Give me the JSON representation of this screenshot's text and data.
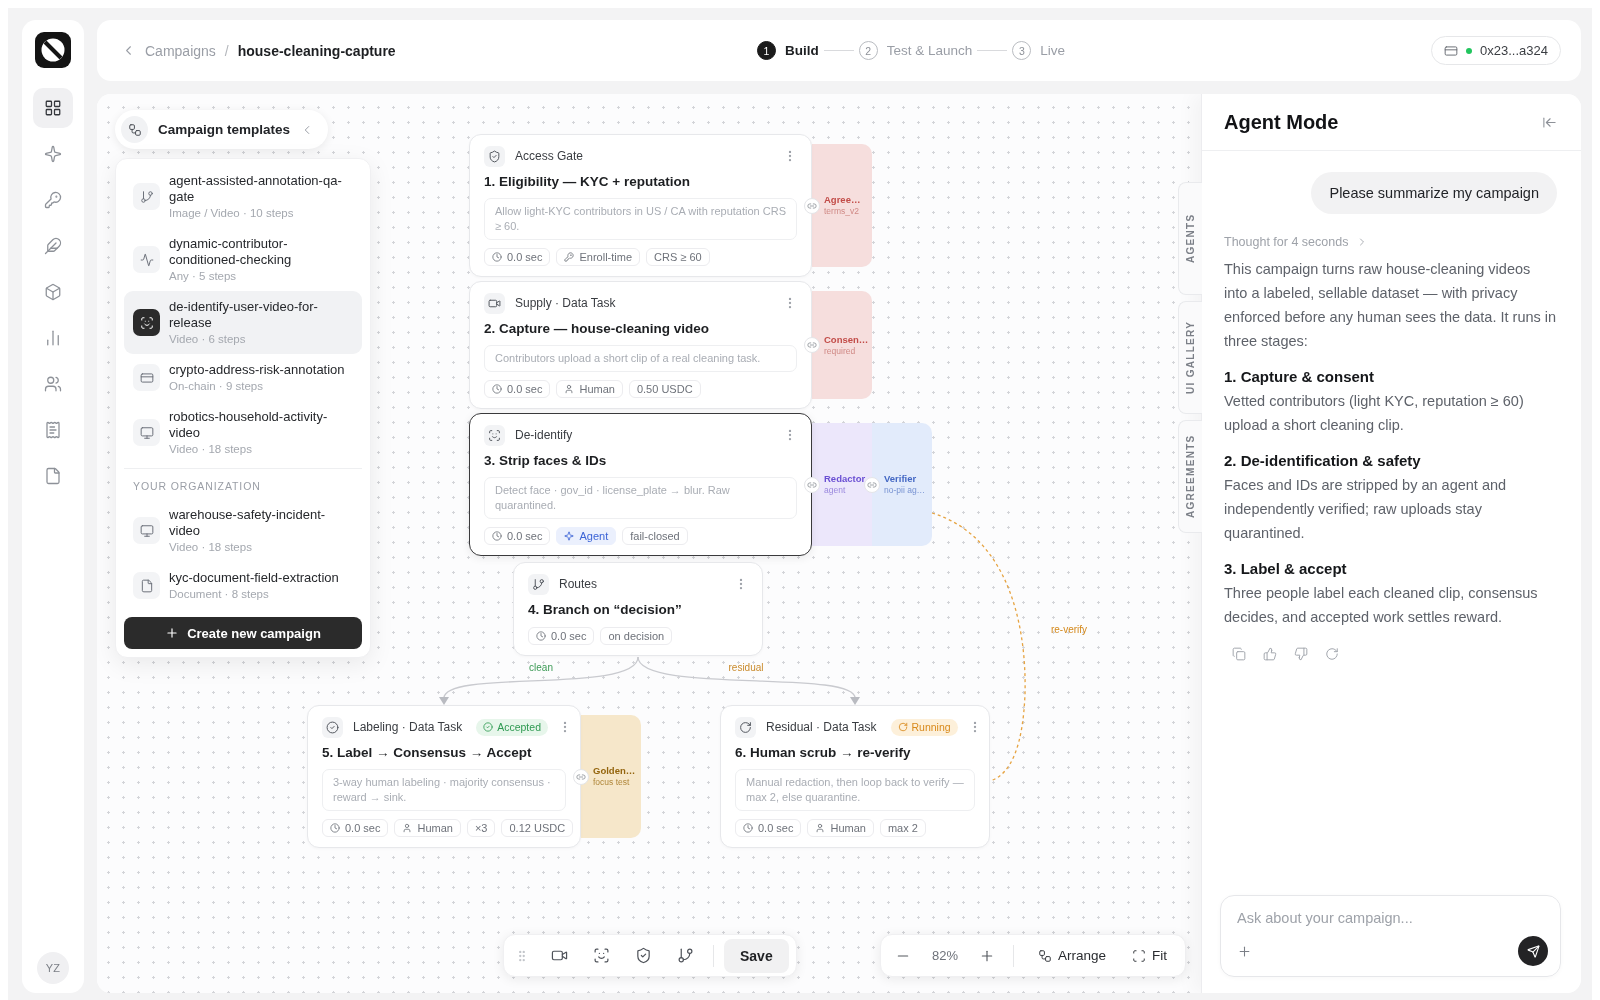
{
  "sidebar": {
    "nav_items": [
      {
        "selected": true
      },
      {
        "selected": false
      },
      {
        "selected": false
      },
      {
        "selected": false
      },
      {
        "selected": false
      },
      {
        "selected": false
      },
      {
        "selected": false
      },
      {
        "selected": false
      },
      {
        "selected": false
      }
    ],
    "avatar": {
      "initials": "YZ"
    }
  },
  "top_bar": {
    "breadcrumb": {
      "parent": "Campaigns",
      "separator": "/",
      "current": "house-cleaning-capture"
    },
    "steps": [
      {
        "number": "1",
        "label": "Build",
        "selected": true
      },
      {
        "number": "2",
        "label": "Test & Launch",
        "selected": false
      },
      {
        "number": "3",
        "label": "Live",
        "selected": false
      }
    ],
    "wallet": {
      "address": "0x23...a324",
      "connected": true
    }
  },
  "templates": {
    "title": "Campaign templates",
    "items": [
      {
        "kind": "qa-gate",
        "title": "agent-assisted-annotation-qa-gate",
        "meta": "Image / Video · 10 steps",
        "selected": false
      },
      {
        "kind": "conditional",
        "title": "dynamic-contributor-conditioned-checking",
        "meta": "Any · 5 steps",
        "selected": false
      },
      {
        "kind": "de-identify",
        "title": "de-identify-user-video-for-release",
        "meta": "Video · 6 steps",
        "selected": true
      },
      {
        "kind": "risk",
        "title": "crypto-address-risk-annotation",
        "meta": "On-chain · 9 steps",
        "selected": false
      },
      {
        "kind": "video",
        "title": "robotics-household-activity-video",
        "meta": "Video · 18 steps",
        "selected": false
      }
    ],
    "organization": {
      "heading": "YOUR ORGANIZATION",
      "items": [
        {
          "kind": "video",
          "title": "warehouse-safety-incident-video",
          "meta": "Video · 18 steps",
          "selected": false
        },
        {
          "kind": "document",
          "title": "kyc-document-field-extraction",
          "meta": "Document · 8 steps",
          "selected": false
        }
      ]
    },
    "create_button": "Create new campaign"
  },
  "canvas": {
    "nodes": [
      {
        "kind": "gate",
        "type": "Access Gate",
        "title": "1. Eligibility — KYC + reputation",
        "description": "Allow light-KYC contributors in US / CA with reputation CRS ≥ 60.",
        "chips": [
          {
            "kind": "time",
            "label": "0.0 sec"
          },
          {
            "kind": "trigger",
            "label": "Enroll-time"
          },
          {
            "kind": "plain",
            "label": "CRS ≥ 60"
          }
        ],
        "attachments": [
          {
            "kind": "agreement",
            "title": "Agree…",
            "subtitle": "terms_v2"
          }
        ],
        "selected": false
      },
      {
        "kind": "capture",
        "type": "Supply · Data Task",
        "title": "2. Capture — house-cleaning video",
        "description": "Contributors upload a short clip of a real cleaning task.",
        "chips": [
          {
            "kind": "time",
            "label": "0.0 sec"
          },
          {
            "kind": "human",
            "label": "Human"
          },
          {
            "kind": "plain",
            "label": "0.50 USDC"
          }
        ],
        "attachments": [
          {
            "kind": "agreement",
            "title": "Consen…",
            "subtitle": "required"
          }
        ],
        "selected": false
      },
      {
        "kind": "deidentify",
        "type": "De-identify",
        "title": "3. Strip faces & IDs",
        "description": "Detect face · gov_id · license_plate → blur. Raw quarantined.",
        "chips": [
          {
            "kind": "time",
            "label": "0.0 sec"
          },
          {
            "kind": "agent",
            "label": "Agent"
          },
          {
            "kind": "plain",
            "label": "fail-closed"
          }
        ],
        "attachments": [
          {
            "kind": "agent",
            "title": "Redactor",
            "subtitle": "agent"
          },
          {
            "kind": "verifier",
            "title": "Verifier",
            "subtitle": "no-pii ag…"
          }
        ],
        "selected": true
      },
      {
        "kind": "routes",
        "type": "Routes",
        "title": "4. Branch on “decision”",
        "chips": [
          {
            "kind": "time",
            "label": "0.0 sec"
          },
          {
            "kind": "plain",
            "label": "on decision"
          }
        ],
        "selected": false
      },
      {
        "kind": "labeling",
        "type": "Labeling · Data Task",
        "status": {
          "kind": "accepted",
          "label": "Accepted"
        },
        "title": "5. Label → Consensus → Accept",
        "description": "3-way human labeling · majority consensus · reward → sink.",
        "chips": [
          {
            "kind": "time",
            "label": "0.0 sec"
          },
          {
            "kind": "human",
            "label": "Human"
          },
          {
            "kind": "plain",
            "label": "×3"
          },
          {
            "kind": "plain",
            "label": "0.12 USDC"
          }
        ],
        "attachments": [
          {
            "kind": "golden",
            "title": "Golden…",
            "subtitle": "focus test"
          }
        ],
        "selected": false
      },
      {
        "kind": "residual",
        "type": "Residual · Data Task",
        "status": {
          "kind": "running",
          "label": "Running"
        },
        "title": "6. Human scrub → re-verify",
        "description": "Manual redaction, then loop back to verify — max 2, else quarantine.",
        "chips": [
          {
            "kind": "time",
            "label": "0.0 sec"
          },
          {
            "kind": "human",
            "label": "Human"
          },
          {
            "kind": "plain",
            "label": "max 2"
          }
        ],
        "selected": false
      }
    ],
    "edges": [
      {
        "kind": "clean",
        "label": "clean"
      },
      {
        "kind": "residual",
        "label": "residual"
      },
      {
        "kind": "loop",
        "label": "re-verify"
      }
    ]
  },
  "toolbar": {
    "save_button": "Save"
  },
  "zoom_controls": {
    "zoom": "82%",
    "arrange_button": "Arrange",
    "fit_button": "Fit"
  },
  "side_tabs": [
    {
      "label": "AGENTS",
      "selected": false
    },
    {
      "label": "UI GALLERY",
      "selected": false
    },
    {
      "label": "AGREEMENTS",
      "selected": false
    }
  ],
  "agent_panel": {
    "title": "Agent Mode",
    "user_message": "Please summarize my campaign",
    "reply": {
      "thought": "Thought for 4 seconds",
      "intro": "This campaign turns raw house-cleaning videos into a labeled, sellable dataset — with privacy enforced before any human sees the data. It runs in three stages:",
      "sections": [
        {
          "heading": "1. Capture & consent",
          "body": "Vetted contributors (light KYC, reputation ≥ 60) upload a short cleaning clip."
        },
        {
          "heading": "2. De-identification & safety",
          "body": "Faces and IDs are stripped by an agent and independently verified; raw uploads stay quarantined."
        },
        {
          "heading": "3. Label & accept",
          "body": "Three people label each cleaned clip, consensus decides, and accepted work settles reward."
        }
      ]
    },
    "input": {
      "placeholder": "Ask about your campaign..."
    }
  }
}
